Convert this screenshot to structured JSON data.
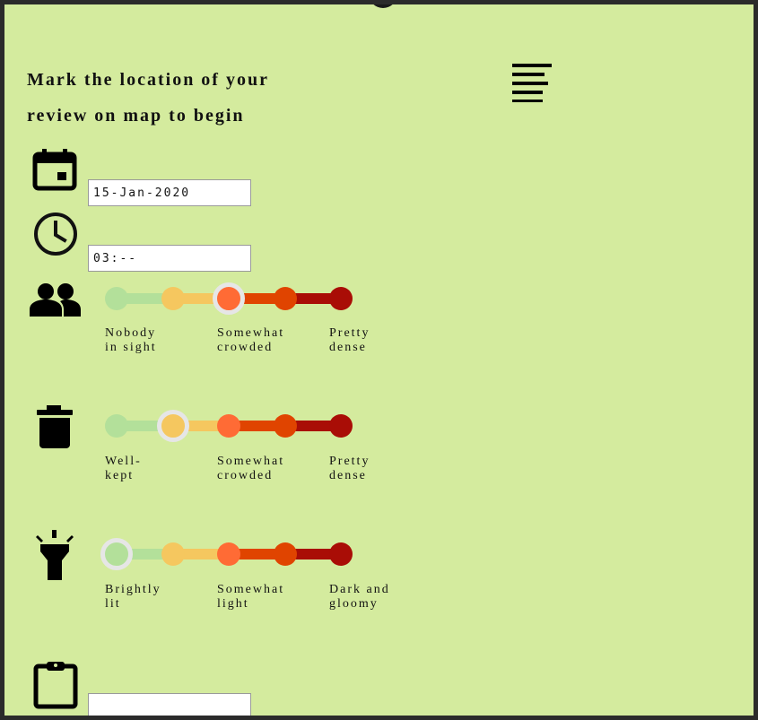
{
  "heading": "Mark the location of your review on map to begin",
  "date_field": {
    "value": "15-Jan-2020"
  },
  "time_field": {
    "value": "03:--"
  },
  "notes_field": {
    "value": ""
  },
  "colors": {
    "background": "#d4eb9e",
    "level1": "#b3e09a",
    "level2": "#f5c75f",
    "level3": "#ff6b35",
    "level4": "#e04400",
    "level5": "#a90d06",
    "selected_ring": "#e6e6e6"
  },
  "icons": [
    "calendar-icon",
    "clock-icon",
    "people-icon",
    "trash-icon",
    "flashlight-icon",
    "clipboard-icon",
    "menu-icon"
  ],
  "scales": [
    {
      "name": "crowd",
      "selected_level": 3,
      "labels": [
        "Nobody in sight",
        "Somewhat crowded",
        "Pretty dense"
      ]
    },
    {
      "name": "cleanliness",
      "selected_level": 2,
      "labels": [
        "Well-kept",
        "Somewhat crowded",
        "Pretty dense"
      ]
    },
    {
      "name": "lighting",
      "selected_level": 1,
      "labels": [
        "Brightly lit",
        "Somewhat light",
        "Dark and gloomy"
      ]
    }
  ]
}
